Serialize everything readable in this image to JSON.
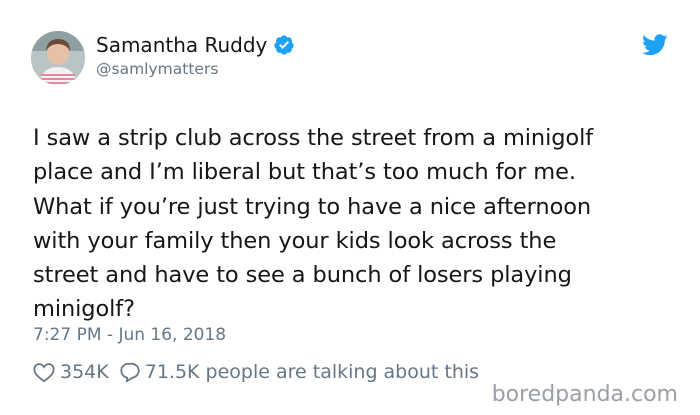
{
  "author": {
    "display_name": "Samantha Ruddy",
    "handle": "@samlymatters",
    "verified": true
  },
  "tweet": {
    "text": "I saw a strip club across the street from a minigolf\nplace and I’m liberal but that’s too much for me.\nWhat if you’re just trying to have a nice afternoon\nwith your family then your kids look across the\nstreet and have to see a bunch of losers playing\nminigolf?",
    "timestamp": "7:27 PM - Jun 16, 2018"
  },
  "engagement": {
    "likes": "354K",
    "replies": "71.5K people are talking about this"
  },
  "watermark": "boredpanda.com",
  "colors": {
    "twitter_blue": "#1da1f2",
    "text": "#14171a",
    "muted": "#657786"
  },
  "icons": {
    "brand": "twitter-bird-icon",
    "verified": "verified-badge-icon",
    "like": "heart-outline-icon",
    "reply": "speech-bubble-icon"
  }
}
